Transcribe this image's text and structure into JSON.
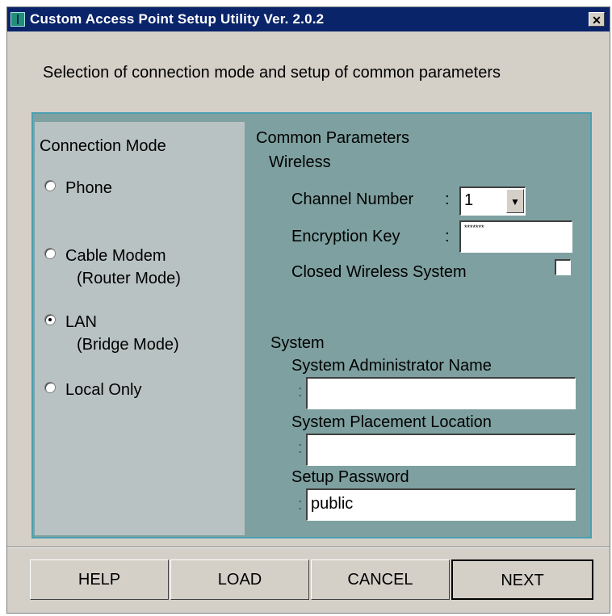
{
  "window": {
    "title": "Custom Access Point Setup Utility  Ver. 2.0.2",
    "close_label": "✕"
  },
  "subtitle": "Selection of connection mode and setup of common parameters",
  "connection_mode": {
    "heading": "Connection Mode",
    "options": [
      {
        "label": "Phone",
        "sublabel": "",
        "checked": false
      },
      {
        "label": "Cable Modem",
        "sublabel": "(Router Mode)",
        "checked": false
      },
      {
        "label": "LAN",
        "sublabel": "(Bridge Mode)",
        "checked": true
      },
      {
        "label": "Local Only",
        "sublabel": "",
        "checked": false
      }
    ]
  },
  "common": {
    "heading": "Common Parameters",
    "wireless": {
      "heading": "Wireless",
      "channel_label": "Channel Number",
      "channel_colon": ":",
      "channel_value": "1",
      "encryption_label": "Encryption Key",
      "encryption_colon": ":",
      "encryption_value": "*******",
      "closed_label": "Closed Wireless System",
      "closed_checked": false
    },
    "system": {
      "heading": "System",
      "admin_label": "System Administrator Name",
      "admin_value": "",
      "location_label": "System Placement Location",
      "location_value": "",
      "password_label": "Setup Password",
      "password_value": "public",
      "colon": ":"
    }
  },
  "buttons": {
    "help": "HELP",
    "load": "LOAD",
    "cancel": "CANCEL",
    "next": "NEXT"
  }
}
